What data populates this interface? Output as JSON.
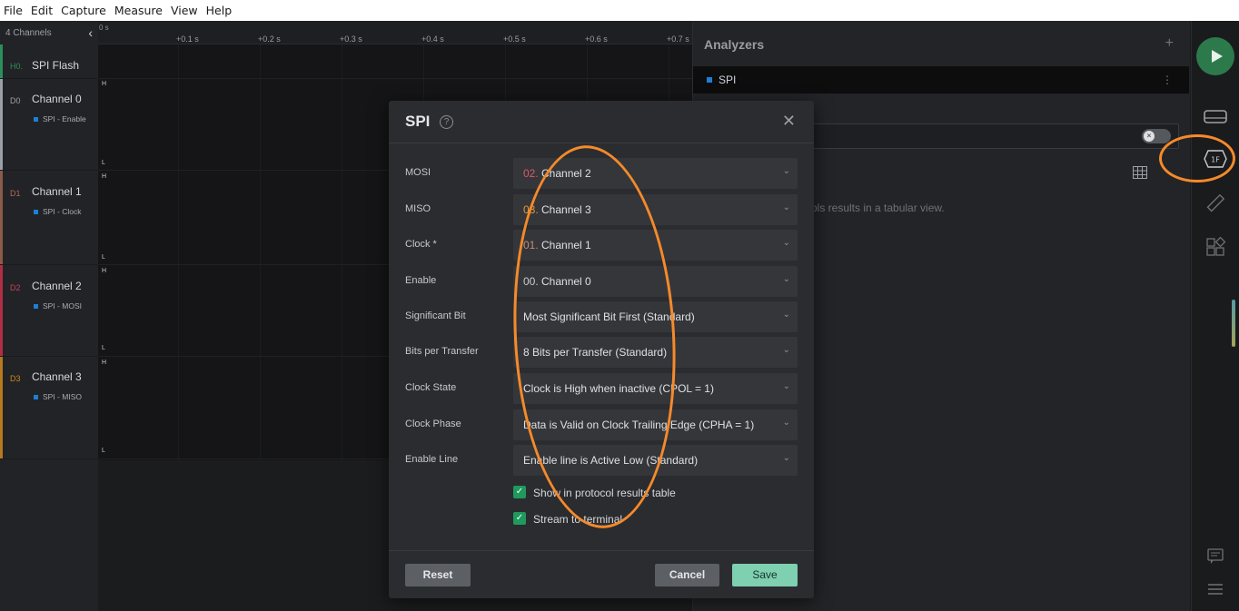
{
  "menu": [
    "File",
    "Edit",
    "Capture",
    "Measure",
    "View",
    "Help"
  ],
  "channels_panel": {
    "header": "4 Channels",
    "rows": [
      {
        "code": "H0.",
        "name": "SPI Flash",
        "tag": "",
        "color": "#2a8f5a"
      },
      {
        "code": "D0",
        "name": "Channel 0",
        "tag": "SPI - Enable",
        "color": "#9aa0a6"
      },
      {
        "code": "D1",
        "name": "Channel 1",
        "tag": "SPI - Clock",
        "color": "#8a5a4a"
      },
      {
        "code": "D2",
        "name": "Channel 2",
        "tag": "SPI - MOSI",
        "color": "#b02f45"
      },
      {
        "code": "D3",
        "name": "Channel 3",
        "tag": "SPI - MISO",
        "color": "#b5791f"
      }
    ]
  },
  "timeline": {
    "origin": "0 s",
    "ticks": [
      "+0.1 s",
      "+0.2 s",
      "+0.3 s",
      "+0.4 s",
      "+0.5 s",
      "+0.6 s",
      "+0.7 s"
    ],
    "high": "H",
    "low": "L"
  },
  "analyzers": {
    "title": "Analyzers",
    "add": "+",
    "item": "SPI",
    "more": "⋮",
    "hint": "ols results in a tabular view."
  },
  "dialog": {
    "title": "SPI",
    "help": "?",
    "close": "✕",
    "fields": [
      {
        "label": "MOSI",
        "num": "02.",
        "num_color": "#e0566e",
        "value": "Channel 2"
      },
      {
        "label": "MISO",
        "num": "03.",
        "num_color": "#e09a3a",
        "value": "Channel 3"
      },
      {
        "label": "Clock *",
        "num": "01.",
        "num_color": "#c08a7a",
        "value": "Channel 1"
      },
      {
        "label": "Enable",
        "num": "00.",
        "num_color": "#c9cbcf",
        "value": "Channel 0"
      },
      {
        "label": "Significant Bit",
        "num": "",
        "value": "Most Significant Bit First (Standard)"
      },
      {
        "label": "Bits per Transfer",
        "num": "",
        "value": "8 Bits per Transfer (Standard)"
      },
      {
        "label": "Clock State",
        "num": "",
        "value": "Clock is High when inactive (CPOL = 1)"
      },
      {
        "label": "Clock Phase",
        "num": "",
        "value": "Data is Valid on Clock Trailing Edge (CPHA = 1)"
      },
      {
        "label": "Enable Line",
        "num": "",
        "value": "Enable line is Active Low (Standard)"
      }
    ],
    "checkboxes": [
      {
        "label": "Show in protocol results table",
        "checked": true
      },
      {
        "label": "Stream to terminal",
        "checked": true
      }
    ],
    "reset": "Reset",
    "cancel": "Cancel",
    "save": "Save"
  },
  "sidebar_icons": [
    "play-icon",
    "hardware-icon",
    "protocol-1f-icon",
    "ruler-icon",
    "extensions-icon",
    "chat-icon",
    "menu-icon"
  ],
  "colors": {
    "accent_green": "#2c7a4b",
    "save": "#7fcfb1",
    "annotation": "#f58a2a"
  }
}
